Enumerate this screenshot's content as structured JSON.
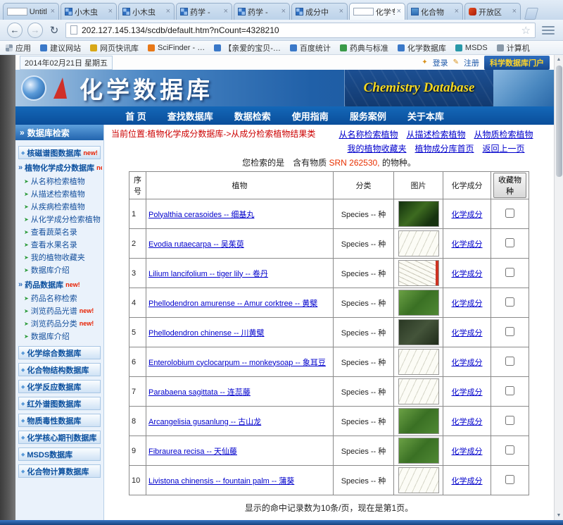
{
  "colors": {
    "accent_blue": "#0a4f9e",
    "link_blue": "#0000cc",
    "breadcrumb_red": "#cc0000",
    "new_badge_red": "#e82000",
    "portal_yellow": "#ffd428"
  },
  "icons": {
    "back": "←",
    "forward": "→",
    "reload": "↻",
    "star": "☆",
    "close": "×",
    "chevrons": "»",
    "leaf": "➤",
    "diamond": "◆",
    "key": "✦",
    "pen": "✎",
    "up": "▲",
    "down": "▼"
  },
  "browser": {
    "url": "202.127.145.134/scdb/default.htm?nCount=4328210",
    "tabs": [
      {
        "label": "Untitl",
        "icon": "page",
        "active": false
      },
      {
        "label": "小木虫",
        "icon": "grid",
        "active": false
      },
      {
        "label": "小木虫",
        "icon": "grid",
        "active": false
      },
      {
        "label": "药学 -",
        "icon": "grid",
        "active": false
      },
      {
        "label": "药学 -",
        "icon": "grid",
        "active": false
      },
      {
        "label": "成分中",
        "icon": "grid",
        "active": false
      },
      {
        "label": "化学专",
        "icon": "page",
        "active": true
      },
      {
        "label": "化合物",
        "icon": "site",
        "active": false
      },
      {
        "label": "开放区",
        "icon": "red",
        "active": false
      }
    ],
    "bookmarks": [
      {
        "label": "应用",
        "icon": "apps"
      },
      {
        "label": "建议网站",
        "icon": "site-blue"
      },
      {
        "label": "网页快讯库",
        "icon": "site-gold"
      },
      {
        "label": "SciFinder - …",
        "icon": "site-orange"
      },
      {
        "label": "【亲爱的宝贝-…",
        "icon": "site-blue"
      },
      {
        "label": "百度统计",
        "icon": "site-blue"
      },
      {
        "label": "药典与标准",
        "icon": "site-green"
      },
      {
        "label": "化学数据库",
        "icon": "site-blue"
      },
      {
        "label": "MSDS",
        "icon": "site-teal"
      },
      {
        "label": "计算机",
        "icon": "site-gray"
      }
    ]
  },
  "page": {
    "topbar": {
      "date": "2014年02月21日 星期五",
      "login": "登录",
      "register": "注册",
      "portal": "科学数据库门户"
    },
    "banner": {
      "title": "化学数据库",
      "subtitle": "Chemistry Database"
    },
    "nav": [
      "首 页",
      "查找数据库",
      "数据检索",
      "使用指南",
      "服务案例",
      "关于本库"
    ],
    "sidebar": {
      "title": "数据库检索",
      "items": [
        {
          "type": "section",
          "label": "核磁谱图数据库",
          "new": true
        },
        {
          "type": "group",
          "label": "植物化学成分数据库",
          "new": true
        },
        {
          "type": "sub",
          "label": "从名称检索植物"
        },
        {
          "type": "sub",
          "label": "从描述检索植物"
        },
        {
          "type": "sub",
          "label": "从疾病检索植物"
        },
        {
          "type": "sub",
          "label": "从化学成分检索植物"
        },
        {
          "type": "sub",
          "label": "查看蔬菜名录"
        },
        {
          "type": "sub",
          "label": "查看水果名录"
        },
        {
          "type": "sub",
          "label": "我的植物收藏夹"
        },
        {
          "type": "sub",
          "label": "数据库介绍"
        },
        {
          "type": "group",
          "label": "药品数据库",
          "new": true
        },
        {
          "type": "sub",
          "label": "药品名称检索"
        },
        {
          "type": "sub",
          "label": "浏览药品光谱",
          "new": true
        },
        {
          "type": "sub",
          "label": "浏览药品分类",
          "new": true
        },
        {
          "type": "sub",
          "label": "数据库介绍"
        },
        {
          "type": "section",
          "label": "化学综合数据库"
        },
        {
          "type": "section",
          "label": "化合物结构数据库"
        },
        {
          "type": "section",
          "label": "化学反应数据库"
        },
        {
          "type": "section",
          "label": "红外谱图数据库"
        },
        {
          "type": "section",
          "label": "物质毒性数据库"
        },
        {
          "type": "section",
          "label": "化学核心期刊数据库"
        },
        {
          "type": "section",
          "label": "MSDS数据库"
        },
        {
          "type": "section",
          "label": "化合物计算数据库"
        }
      ]
    },
    "main": {
      "breadcrumb": "当前位置:植物化学成分数据库->从成分检索植物结果类",
      "quick_links": [
        "从名称检索植物",
        "从描述检索植物",
        "从物质检索植物",
        "我的植物收藏夹",
        "植物成分库首页",
        "返回上一页"
      ],
      "result_prefix": "您检索的是　含有物质 ",
      "result_srn": "SRN 262530,",
      "result_suffix": " 的物种。",
      "table": {
        "headers": [
          "序号",
          "植物",
          "分类",
          "图片",
          "化学成分"
        ],
        "fav_button": "收藏物种",
        "component_link": "化学成分",
        "rows": [
          {
            "no": "1",
            "plant": "Polyalthia cerasoides -- 细基丸",
            "category": "Species -- 种",
            "image": "photo-dark"
          },
          {
            "no": "2",
            "plant": "Evodia rutaecarpa -- 吴茱萸",
            "category": "Species -- 种",
            "image": "drawing"
          },
          {
            "no": "3",
            "plant": "Lilium lancifolium -- tiger lily -- 卷丹",
            "category": "Species -- 种",
            "image": "drawing-stamp"
          },
          {
            "no": "4",
            "plant": "Phellodendron amurense -- Amur corktree -- 黄檗",
            "category": "Species -- 种",
            "image": "photo-green"
          },
          {
            "no": "5",
            "plant": "Phellodendron chinense -- 川黄檗",
            "category": "Species -- 种",
            "image": "photo-dim"
          },
          {
            "no": "6",
            "plant": "Enterolobium cyclocarpum -- monkeysoap -- 象耳豆",
            "category": "Species -- 种",
            "image": "drawing"
          },
          {
            "no": "7",
            "plant": "Parabaena sagittata -- 连蕊藤",
            "category": "Species -- 种",
            "image": "drawing"
          },
          {
            "no": "8",
            "plant": "Arcangelisia gusanlung -- 古山龙",
            "category": "Species -- 种",
            "image": "photo-green"
          },
          {
            "no": "9",
            "plant": "Fibraurea recisa -- 天仙藤",
            "category": "Species -- 种",
            "image": "photo-green"
          },
          {
            "no": "10",
            "plant": "Livistona chinensis -- fountain palm -- 蒲葵",
            "category": "Species -- 种",
            "image": "drawing"
          }
        ]
      },
      "footer_note": "显示的命中记录数为10条/页，现在是第1页。"
    }
  }
}
